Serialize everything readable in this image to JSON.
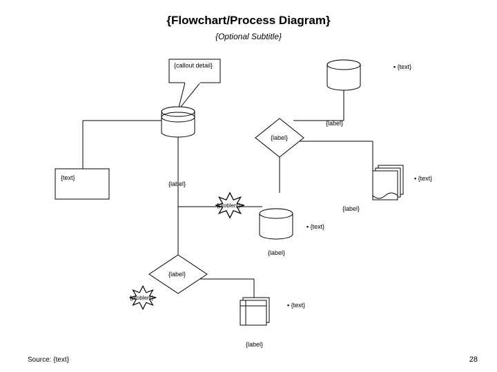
{
  "title": "{Flowchart/Process Diagram}",
  "subtitle": "{Optional Subtitle}",
  "source": "Source: {text}",
  "page_number": "28",
  "labels": {
    "callout": "{callout detail}",
    "cyl_top_right": "{text}",
    "diamond_upper": "{label}",
    "db_label_mid": "{label}",
    "box_left": "{text}",
    "below_cyl_left": "{label}",
    "doc_stack": "{text}",
    "problem1": "{problem}",
    "doc_stack_label": "{label}",
    "cyl_mid": "{text}",
    "below_cyl_mid": "{label}",
    "diamond_lower": "{label}",
    "problem2": "{problem}",
    "card": "{text}",
    "bottom": "{label}"
  }
}
